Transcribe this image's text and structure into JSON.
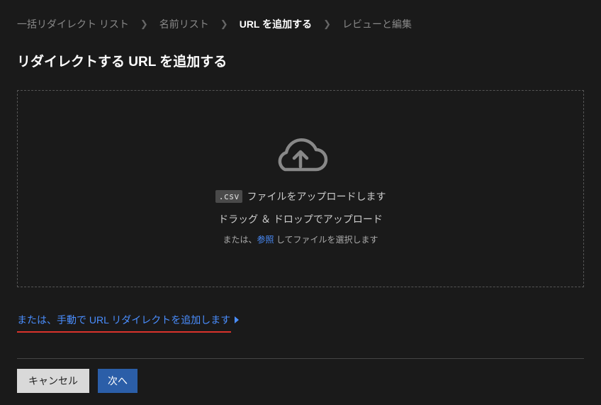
{
  "breadcrumb": {
    "items": [
      {
        "label": "一括リダイレクト リスト"
      },
      {
        "label": "名前リスト"
      },
      {
        "label": "URL を追加する"
      },
      {
        "label": "レビューと編集"
      }
    ],
    "active_index": 2
  },
  "page_title": "リダイレクトする URL を追加する",
  "dropzone": {
    "csv_badge": ".csv",
    "upload_suffix": "ファイルをアップロードします",
    "drag_text": "ドラッグ ＆ ドロップでアップロード",
    "or_prefix": "または、",
    "browse_label": "参照",
    "or_suffix": " してファイルを選択します"
  },
  "manual_link": "または、手動で URL リダイレクトを追加します",
  "footer": {
    "cancel": "キャンセル",
    "next": "次へ"
  }
}
